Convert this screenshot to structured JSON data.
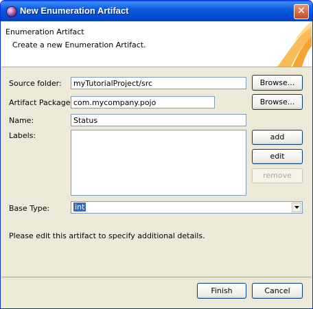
{
  "window": {
    "title": "New Enumeration Artifact",
    "close_glyph": "✕"
  },
  "banner": {
    "title": "Enumeration Artifact",
    "description": "Create a new Enumeration Artifact."
  },
  "form": {
    "source_folder": {
      "label": "Source folder:",
      "value": "myTutorialProject/src",
      "button": "Browse..."
    },
    "artifact_package": {
      "label": "Artifact Package:",
      "value": "com.mycompany.pojo",
      "button": "Browse..."
    },
    "name": {
      "label": "Name:",
      "value": "Status"
    },
    "labels": {
      "label": "Labels:",
      "items": [],
      "add_label": "add",
      "edit_label": "edit",
      "remove_label": "remove"
    },
    "base_type": {
      "label": "Base Type:",
      "value": "int"
    }
  },
  "note": "Please edit this artifact to specify additional details.",
  "footer": {
    "finish_label": "Finish",
    "cancel_label": "Cancel"
  },
  "colors": {
    "title_bar": "#0a5ce0",
    "dialog_bg": "#ece9d8",
    "selection": "#316ac5",
    "close_button": "#c44b22"
  }
}
